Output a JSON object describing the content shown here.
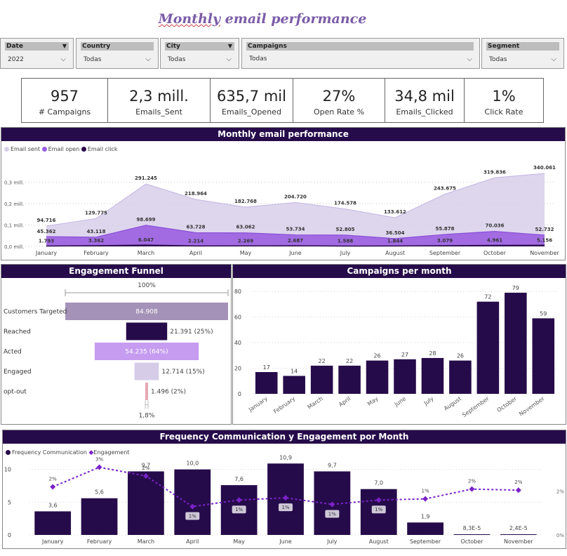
{
  "title": "Monthly email performance",
  "title_parts": [
    "Monthly",
    " email performance"
  ],
  "slicers": [
    {
      "label": "Date",
      "value": "2022"
    },
    {
      "label": "Country",
      "value": "Todas"
    },
    {
      "label": "City",
      "value": "Todas"
    },
    {
      "label": "Campaigns",
      "value": "Todas"
    },
    {
      "label": "Segment",
      "value": "Todas"
    }
  ],
  "kpis": [
    {
      "value": "957",
      "label": "# Campaigns"
    },
    {
      "value": "2,3 mill.",
      "label": "Emails_Sent"
    },
    {
      "value": "635,7 mil",
      "label": "Emails_Opened"
    },
    {
      "value": "27%",
      "label": "Open Rate %"
    },
    {
      "value": "34,8 mil",
      "label": "Emails_Clicked"
    },
    {
      "value": "1%",
      "label": "Click Rate"
    }
  ],
  "colors": {
    "header": "#260b4a",
    "sent": "#d8cfea",
    "open": "#9b5fe0",
    "click": "#2a0a4a",
    "bar": "#260b4a",
    "engagement": "#7a22c8"
  },
  "chart_data": [
    {
      "type": "area",
      "title": "Monthly email performance",
      "categories": [
        "January",
        "February",
        "March",
        "April",
        "May",
        "June",
        "July",
        "August",
        "September",
        "October",
        "November"
      ],
      "series": [
        {
          "name": "Email sent",
          "values": [
            94716,
            129775,
            291245,
            218964,
            182768,
            204720,
            174578,
            133612,
            243675,
            319836,
            340061
          ],
          "labels": [
            "94.716",
            "129.775",
            "291.245",
            "218.964",
            "182.768",
            "204.720",
            "174.578",
            "133.612",
            "243.675",
            "319.836",
            "340.061"
          ]
        },
        {
          "name": "Email open",
          "values": [
            45362,
            43118,
            98699,
            63728,
            63062,
            53734,
            52805,
            36504,
            55878,
            70036,
            52732
          ],
          "labels": [
            "45.362",
            "43.118",
            "98.699",
            "63.728",
            "63.062",
            "53.734",
            "52.805",
            "36.504",
            "55.878",
            "70.036",
            "52.732"
          ]
        },
        {
          "name": "Email click",
          "values": [
            1793,
            3362,
            6047,
            2214,
            2269,
            2687,
            1588,
            1844,
            3079,
            4961,
            5156
          ],
          "labels": [
            "1.793",
            "3.362",
            "6.047",
            "2.214",
            "2.269",
            "2.687",
            "1.588",
            "1.844",
            "3.079",
            "4.961",
            "5.156"
          ]
        }
      ],
      "yticks": [
        {
          "v": 0,
          "label": "0,0 mill."
        },
        {
          "v": 100000,
          "label": "0,1 mill."
        },
        {
          "v": 200000,
          "label": "0,2 mill."
        },
        {
          "v": 300000,
          "label": "0,3 mill."
        }
      ],
      "ylim": [
        0,
        360000
      ],
      "legend": "top-left"
    },
    {
      "type": "funnel",
      "title": "Engagement Funnel",
      "top_label": "100%",
      "bottom_label": "1,8%",
      "stages": [
        {
          "name": "Customers Targeted",
          "value": 84908,
          "label": "84.908",
          "color": "#a492b8"
        },
        {
          "name": "Reached",
          "value": 21391,
          "label": "21.391 (25%)",
          "color": "#260b4a"
        },
        {
          "name": "Acted",
          "value": 54235,
          "label": "54.235 (64%)",
          "color": "#c59cf0"
        },
        {
          "name": "Engaged",
          "value": 12714,
          "label": "12.714 (15%)",
          "color": "#d6cce8"
        },
        {
          "name": "opt-out",
          "value": 1496,
          "label": "1.496 (2%)",
          "color": "#e6a8b4"
        }
      ]
    },
    {
      "type": "bar",
      "title": "Campaigns per month",
      "categories": [
        "January",
        "February",
        "March",
        "April",
        "May",
        "June",
        "July",
        "August",
        "September",
        "October",
        "November"
      ],
      "values": [
        17,
        14,
        22,
        22,
        26,
        27,
        28,
        26,
        72,
        79,
        59
      ],
      "yticks": [
        0,
        20,
        40,
        60,
        80
      ],
      "ylim": [
        0,
        85
      ]
    },
    {
      "type": "bar",
      "title": "Frequency Communication y Engagement por Month",
      "categories": [
        "January",
        "February",
        "March",
        "April",
        "May",
        "June",
        "July",
        "August",
        "September",
        "October",
        "November"
      ],
      "series": [
        {
          "name": "Frequency Communication",
          "values": [
            3.6,
            5.6,
            9.7,
            10.0,
            7.6,
            10.9,
            9.7,
            7.0,
            1.9,
            8.3e-05,
            2.4e-05
          ],
          "labels": [
            "3,6",
            "5,6",
            "9,7",
            "10,0",
            "7,6",
            "10,9",
            "9,7",
            "7,0",
            "1,9",
            "8,3E-5",
            "2,4E-5"
          ]
        },
        {
          "name": "Engagement",
          "type": "line",
          "values": [
            2.2,
            3.1,
            2.7,
            1.3,
            1.6,
            1.7,
            1.4,
            1.6,
            1.65,
            2.1,
            2.05
          ],
          "labels": [
            "2%",
            "3%",
            "2%",
            "1%",
            "1%",
            "1%",
            "1%",
            "1%",
            "1%",
            "2%",
            "2%"
          ]
        }
      ],
      "yticks": [
        0,
        5,
        10
      ],
      "ylim": [
        0,
        12
      ],
      "y2ticks": [
        "0%",
        "2%"
      ]
    }
  ]
}
